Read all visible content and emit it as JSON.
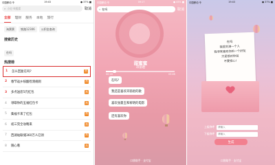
{
  "panel1": {
    "status_left": "中国移动 令",
    "status_time": "19:43",
    "status_right": "● 37% ■",
    "search_placeholder": "小红书搜索",
    "cancel_label": "取消",
    "tabs": [
      "全部",
      "理财",
      "服务",
      "本地",
      "旅行"
    ],
    "chips": [
      "淘票票",
      "铁路12306",
      "公积金查询"
    ],
    "history_title": "搜索历史",
    "history_items": [
      "在吗"
    ],
    "hot_title": "热搜榜",
    "hot_list": [
      {
        "rank": "1",
        "text": "怎么回复在吗?"
      },
      {
        "rank": "2",
        "text": "春节返乡核酸检测规则"
      },
      {
        "rank": "3",
        "text": "多点送您5元红包"
      },
      {
        "rank": "4",
        "text": "领取你的五福红包卡"
      },
      {
        "rank": "5",
        "text": "集福卡来了红包"
      },
      {
        "rank": "6",
        "text": "初三完全攻略来"
      },
      {
        "rank": "7",
        "text": "西湖站联储360万人已领"
      },
      {
        "rank": "8",
        "text": "随心看"
      }
    ]
  },
  "panel2": {
    "status_left": "中国移动 令",
    "status_time": "09:17",
    "status_right": "● 45% ■",
    "search_value": "在吗",
    "cancel_label": "取消",
    "song_title": "甜蜜蜜",
    "song_artist": "邓丽君",
    "time_start": "00:18",
    "time_end": "03:46",
    "progress": 0.12,
    "bubbles": [
      "在吗?",
      "我还是喜欢邓丽君的歌",
      "喜欢张曼玉和黎明的电影",
      "还有喜欢你"
    ],
    "brand": "口袋助手 · 支付宝"
  },
  "panel3": {
    "status_left": "中国移动 令",
    "status_time": "19:43",
    "status_right": "● 37% ■",
    "letter_lines": [
      "在吗",
      "我是刘涛一个人",
      "我非常喜欢你的一个好友",
      "只是想对你说",
      "不要担心!"
    ],
    "input1_label": "上级称呼",
    "input1_value": "请输入",
    "input2_label": "下级称呼",
    "input2_value": "请输入",
    "generate_label": "生成",
    "brand": "口袋助手 · 支付宝"
  }
}
